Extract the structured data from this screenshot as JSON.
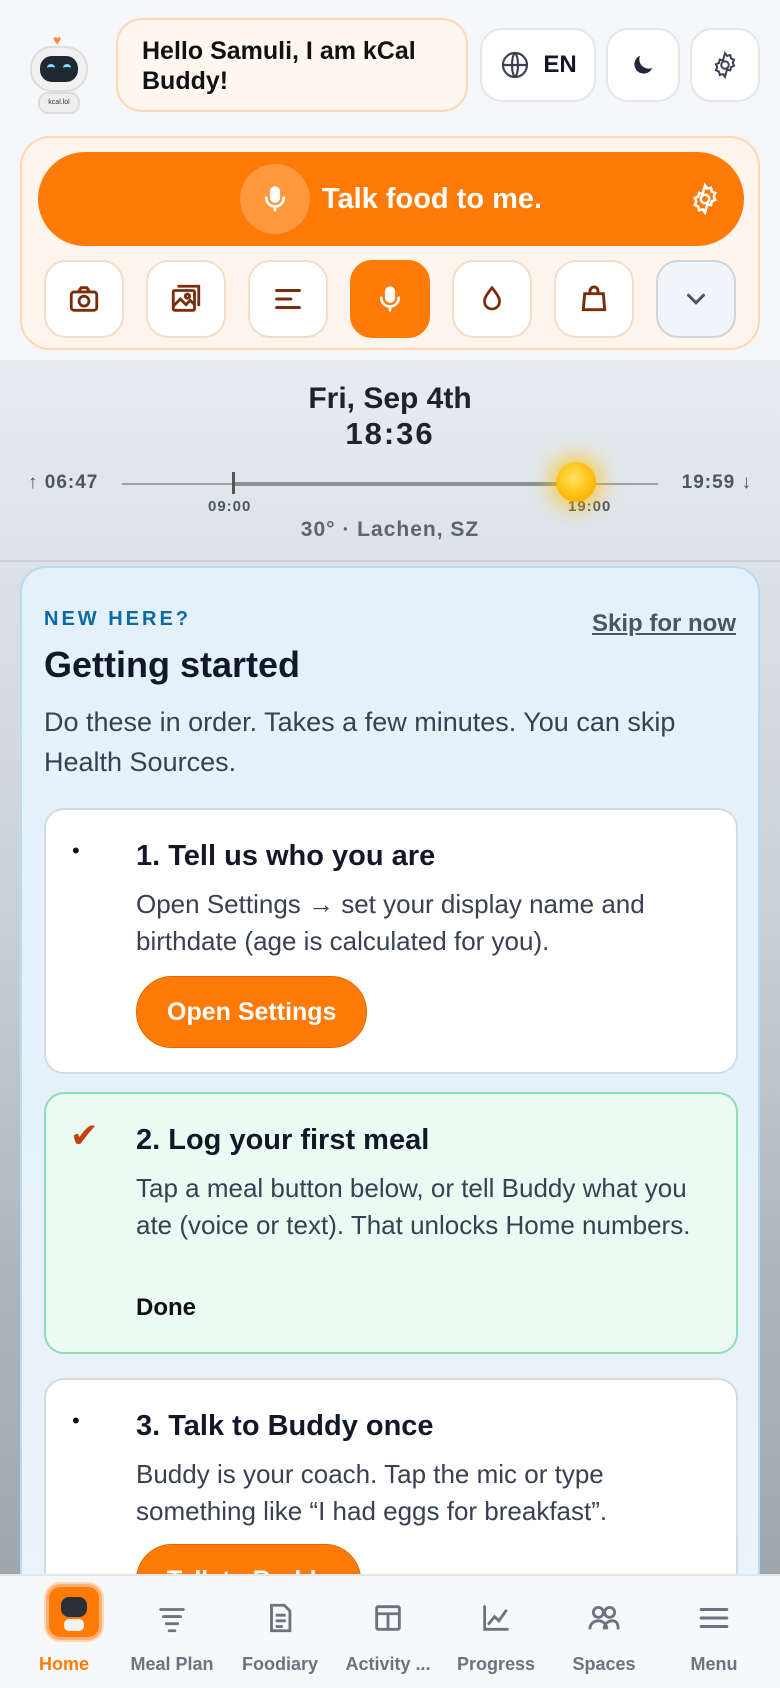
{
  "header": {
    "greeting": "Hello Samuli, I am kCal Buddy!",
    "avatar_text": "kcal.lol",
    "language": "EN"
  },
  "talk": {
    "label": "Talk food to me.",
    "quick_actions": [
      "camera-icon",
      "image-icon",
      "text-lines-icon",
      "mic-icon",
      "water-drop-icon",
      "shopping-bag-icon",
      "chevron-down-icon"
    ],
    "accent": "#ff7a06"
  },
  "sun": {
    "date": "Fri, Sep 4th",
    "time": "18:36",
    "sunrise": "↑ 06:47",
    "sunset": "19:59 ↓",
    "tick_left": "09:00",
    "tick_right": "19:00",
    "location": "30° · Lachen, SZ"
  },
  "getting_started": {
    "kicker": "NEW HERE?",
    "skip": "Skip for now",
    "title": "Getting started",
    "subtitle": "Do these in order. Takes a few minutes. You can skip Health Sources.",
    "steps": [
      {
        "bullet": "•",
        "title": "1. Tell us who you are",
        "desc": "Open Settings → set your display name and birthdate (age is calculated for you).",
        "button": "Open Settings"
      },
      {
        "bullet": "✔",
        "title": "2. Log your first meal",
        "desc": "Tap a meal button below, or tell Buddy what you ate (voice or text). That unlocks Home numbers.",
        "status": "Done"
      },
      {
        "bullet": "•",
        "title": "3. Talk to Buddy once",
        "desc": "Buddy is your coach. Tap the mic or type something like “I had eggs for breakfast”.",
        "button": "Talk to Buddy"
      }
    ]
  },
  "nav": {
    "items": [
      {
        "label": "Home",
        "icon": "home-robot-icon"
      },
      {
        "label": "Meal Plan",
        "icon": "meal-plan-icon"
      },
      {
        "label": "Foodiary",
        "icon": "document-icon"
      },
      {
        "label": "Activity ...",
        "icon": "activity-icon"
      },
      {
        "label": "Progress",
        "icon": "chart-icon"
      },
      {
        "label": "Spaces",
        "icon": "people-icon"
      },
      {
        "label": "Menu",
        "icon": "menu-icon"
      }
    ]
  }
}
